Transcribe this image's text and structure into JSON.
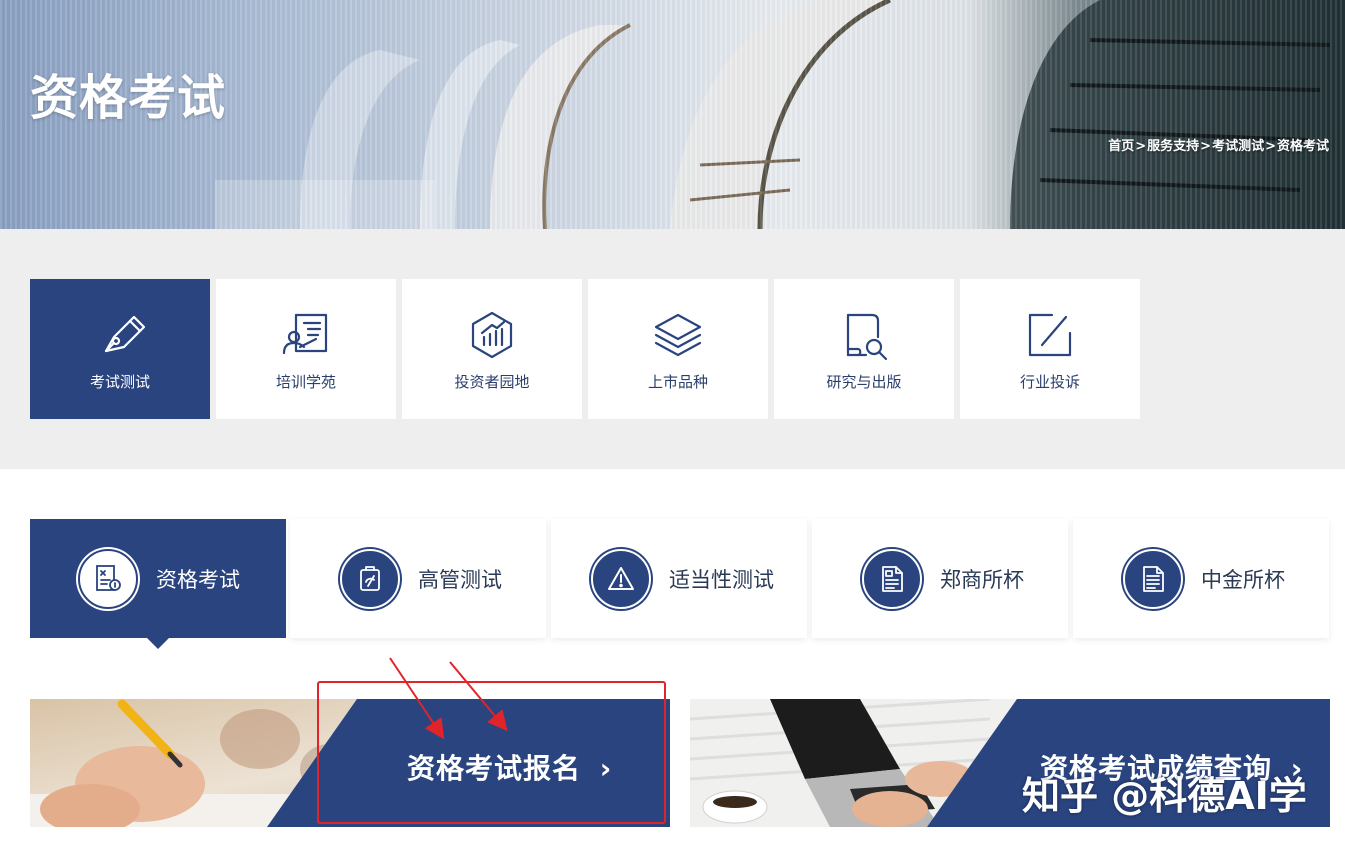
{
  "banner": {
    "title": "资格考试",
    "breadcrumb": [
      {
        "label": "首页"
      },
      {
        "label": "服务支持"
      },
      {
        "label": "考试测试"
      },
      {
        "label": "资格考试"
      }
    ],
    "separator": ">"
  },
  "categories": [
    {
      "label": "考试测试",
      "icon": "exam-pen-icon",
      "active": true
    },
    {
      "label": "培训学苑",
      "icon": "trainer-board-icon",
      "active": false
    },
    {
      "label": "投资者园地",
      "icon": "growth-chart-icon",
      "active": false
    },
    {
      "label": "上市品种",
      "icon": "layers-icon",
      "active": false
    },
    {
      "label": "研究与出版",
      "icon": "document-search-icon",
      "active": false
    },
    {
      "label": "行业投诉",
      "icon": "edit-square-icon",
      "active": false
    }
  ],
  "exam_tabs": [
    {
      "label": "资格考试",
      "icon": "exam-sheet-icon",
      "active": true
    },
    {
      "label": "高管测试",
      "icon": "clipboard-icon",
      "active": false
    },
    {
      "label": "适当性测试",
      "icon": "warning-triangle-icon",
      "active": false
    },
    {
      "label": "郑商所杯",
      "icon": "certificate-doc-icon",
      "active": false
    },
    {
      "label": "中金所杯",
      "icon": "document-lines-icon",
      "active": false
    }
  ],
  "cards": [
    {
      "label": "资格考试报名",
      "arrow": "›"
    },
    {
      "label": "资格考试成绩查询",
      "arrow": "›"
    }
  ],
  "watermark": "知乎 @科德AI学",
  "colors": {
    "primary": "#2a4480",
    "band_bg": "#eeeeee",
    "highlight": "#e0242a"
  }
}
